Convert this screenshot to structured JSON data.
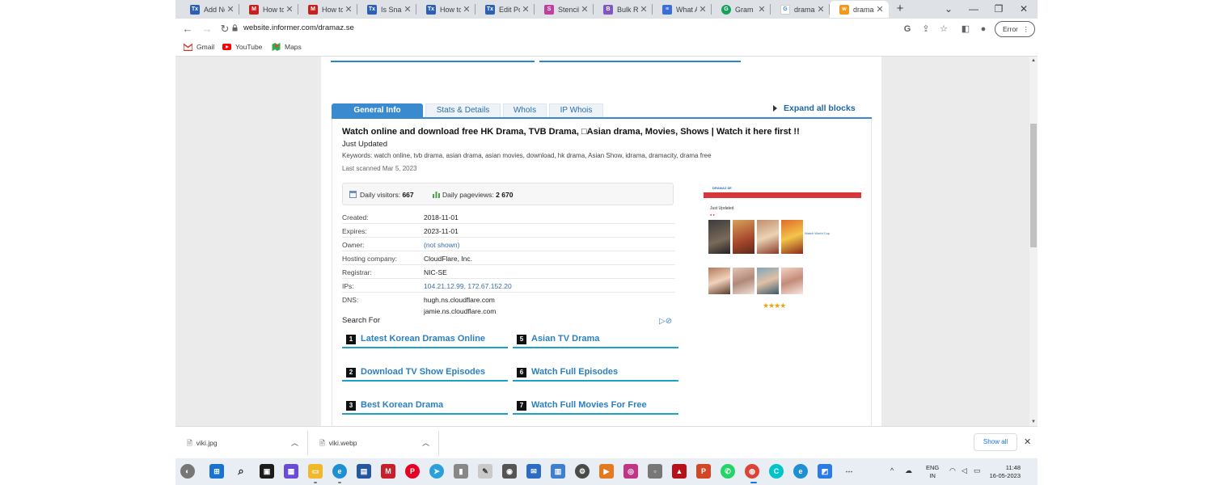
{
  "browser": {
    "tabs": [
      {
        "label": "Add Ne",
        "icon": "tw-icon",
        "color": "#2d5fb3",
        "glyph": "Tx"
      },
      {
        "label": "How to",
        "icon": "gmail-like-icon",
        "color": "#c5221f",
        "glyph": "M"
      },
      {
        "label": "How to",
        "icon": "gmail-like-icon",
        "color": "#c5221f",
        "glyph": "M"
      },
      {
        "label": "Is Snap",
        "icon": "tw-icon",
        "color": "#2d5fb3",
        "glyph": "Tx"
      },
      {
        "label": "How to",
        "icon": "tw-icon",
        "color": "#2d5fb3",
        "glyph": "Tx"
      },
      {
        "label": "Edit Pos",
        "icon": "tw-icon",
        "color": "#2d5fb3",
        "glyph": "Tx"
      },
      {
        "label": "Stencil",
        "icon": "stencil-icon",
        "color": "#c23ea0",
        "glyph": "S"
      },
      {
        "label": "Bulk Re",
        "icon": "bulk-icon",
        "color": "#7e57c2",
        "glyph": "B"
      },
      {
        "label": "What A",
        "icon": "docs-icon",
        "color": "#3b6fd8",
        "glyph": "≡"
      },
      {
        "label": "Gram",
        "icon": "grammarly-icon",
        "color": "#15a15a",
        "glyph": "G"
      },
      {
        "label": "dramaz",
        "icon": "google-icon",
        "color": "#ffffff",
        "glyph": "G"
      },
      {
        "label": "dramaz",
        "icon": "informer-icon",
        "color": "#f39a1e",
        "glyph": "w"
      }
    ],
    "url": "website.informer.com/dramaz.se",
    "error_label": "Error",
    "bookmarks": [
      {
        "label": "Gmail",
        "icon": "gmail-icon"
      },
      {
        "label": "YouTube",
        "icon": "youtube-icon"
      },
      {
        "label": "Maps",
        "icon": "maps-icon"
      }
    ]
  },
  "page": {
    "tabs": [
      "General Info",
      "Stats & Details",
      "WhoIs",
      "IP Whois"
    ],
    "expand_all": "Expand all blocks",
    "title": "Watch online and download free HK Drama, TVB Drama, □Asian drama, Movies, Shows | Watch it here first !!",
    "subtitle": "Just Updated",
    "keywords": "Keywords: watch online, tvb drama, asian drama, asian movies, download, hk drama, Asian Show, idrama, dramacity, drama free",
    "last_scanned": "Last scanned Mar 5, 2023",
    "stats": {
      "visitors_label": "Daily visitors:",
      "visitors_value": "667",
      "pageviews_label": "Daily pageviews:",
      "pageviews_value": "2 670"
    },
    "details": [
      {
        "key": "Created:",
        "value": "2018-11-01"
      },
      {
        "key": "Expires:",
        "value": "2023-11-01"
      },
      {
        "key": "Owner:",
        "value": "(not shown)"
      },
      {
        "key": "Hosting company:",
        "value": "CloudFlare, Inc."
      },
      {
        "key": "Registrar:",
        "value": "NIC-SE"
      },
      {
        "key": "IPs:",
        "value": "104.21.12.99, 172.67.152.20"
      },
      {
        "key": "DNS:",
        "value": "hugh.ns.cloudflare.com",
        "value2": "jamie.ns.cloudflare.com"
      }
    ],
    "search_for": "Search For",
    "search_results": [
      {
        "num": "1",
        "text": "Latest Korean Dramas Online"
      },
      {
        "num": "5",
        "text": "Asian TV Drama"
      },
      {
        "num": "2",
        "text": "Download TV Show Episodes"
      },
      {
        "num": "6",
        "text": "Watch Full Episodes"
      },
      {
        "num": "3",
        "text": "Best Korean Drama"
      },
      {
        "num": "7",
        "text": "Watch Full Movies For Free"
      }
    ],
    "thumbnail": {
      "logo": "DRAMAZ.SE",
      "heading": "Just Updated",
      "side_link": "Watch World Cup",
      "stars": "★★★★"
    }
  },
  "downloads": [
    {
      "name": "viki.jpg"
    },
    {
      "name": "viki.webp"
    }
  ],
  "show_all": "Show all",
  "taskbar": {
    "lang_line1": "ENG",
    "lang_line2": "IN",
    "time": "11:48",
    "date": "16-05-2023"
  }
}
